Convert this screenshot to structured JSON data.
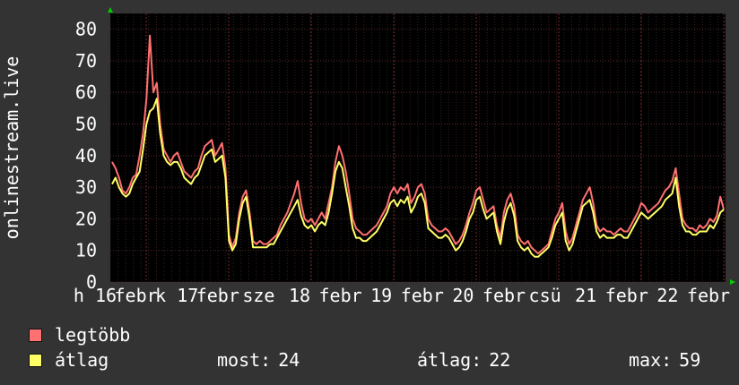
{
  "chart_data": {
    "type": "line",
    "ylabel": "onlinestream.live",
    "ylim": [
      0,
      85
    ],
    "yticks": [
      0,
      10,
      20,
      30,
      40,
      50,
      60,
      70,
      80
    ],
    "x_tick_labels": [
      "h 16",
      "febr",
      "k 17",
      "febr",
      "sze",
      "18",
      "febr",
      "19",
      "febr",
      "20",
      "febr",
      "csü",
      "21",
      "febr",
      "22",
      "febr"
    ],
    "grid": true,
    "background": "#000000",
    "series": [
      {
        "name": "legtöbb",
        "color": "#ff7070",
        "values": [
          38,
          36,
          33,
          29,
          28,
          30,
          33,
          34,
          40,
          47,
          58,
          78,
          60,
          63,
          50,
          42,
          40,
          38,
          40,
          41,
          38,
          35,
          34,
          33,
          35,
          36,
          40,
          43,
          44,
          45,
          40,
          42,
          44,
          36,
          15,
          11,
          14,
          22,
          27,
          29,
          22,
          13,
          12,
          13,
          12,
          12,
          13,
          14,
          15,
          18,
          20,
          22,
          25,
          28,
          32,
          25,
          20,
          19,
          20,
          18,
          20,
          22,
          20,
          25,
          30,
          38,
          43,
          40,
          35,
          28,
          20,
          17,
          16,
          15,
          15,
          16,
          17,
          18,
          20,
          22,
          24,
          28,
          30,
          28,
          30,
          29,
          31,
          25,
          27,
          30,
          31,
          28,
          20,
          18,
          17,
          16,
          16,
          17,
          16,
          14,
          12,
          13,
          15,
          18,
          22,
          25,
          29,
          30,
          26,
          22,
          23,
          24,
          18,
          14,
          22,
          26,
          28,
          24,
          15,
          13,
          12,
          13,
          11,
          10,
          9,
          10,
          11,
          12,
          16,
          20,
          22,
          25,
          16,
          12,
          14,
          18,
          22,
          26,
          28,
          30,
          25,
          18,
          16,
          17,
          16,
          16,
          15,
          16,
          17,
          16,
          16,
          18,
          20,
          22,
          25,
          24,
          22,
          23,
          24,
          25,
          27,
          29,
          30,
          32,
          36,
          28,
          20,
          18,
          17,
          17,
          16,
          18,
          17,
          18,
          20,
          19,
          21,
          27,
          23
        ]
      },
      {
        "name": "átlag",
        "color": "#ffff66",
        "values": [
          31,
          33,
          30,
          28,
          27,
          28,
          31,
          33,
          35,
          42,
          50,
          54,
          55,
          58,
          47,
          40,
          38,
          37,
          38,
          38,
          36,
          33,
          32,
          31,
          33,
          34,
          37,
          40,
          41,
          42,
          38,
          39,
          40,
          33,
          13,
          10,
          12,
          20,
          25,
          27,
          20,
          11,
          11,
          11,
          11,
          11,
          12,
          12,
          14,
          16,
          18,
          20,
          22,
          24,
          26,
          21,
          18,
          17,
          18,
          16,
          18,
          19,
          18,
          22,
          28,
          35,
          38,
          36,
          30,
          24,
          17,
          14,
          14,
          13,
          13,
          14,
          15,
          16,
          18,
          20,
          22,
          25,
          26,
          24,
          26,
          25,
          27,
          22,
          24,
          27,
          28,
          25,
          17,
          16,
          15,
          14,
          14,
          15,
          14,
          12,
          10,
          11,
          13,
          16,
          20,
          22,
          26,
          27,
          23,
          20,
          21,
          22,
          16,
          12,
          19,
          23,
          25,
          21,
          13,
          11,
          10,
          11,
          9,
          8,
          8,
          9,
          10,
          11,
          14,
          18,
          20,
          22,
          13,
          10,
          12,
          16,
          20,
          24,
          25,
          26,
          22,
          16,
          14,
          15,
          14,
          14,
          14,
          15,
          15,
          14,
          14,
          16,
          18,
          20,
          22,
          21,
          20,
          21,
          22,
          23,
          24,
          26,
          27,
          28,
          33,
          24,
          18,
          16,
          16,
          15,
          15,
          16,
          16,
          16,
          18,
          17,
          19,
          22,
          23
        ]
      }
    ]
  },
  "legend": {
    "max_label": "legtöbb",
    "avg_label": "átlag",
    "max_color": "#ff7070",
    "avg_color": "#ffff66"
  },
  "stats": {
    "now_label": "most:",
    "now_value": "24",
    "avg_label": "átlag:",
    "avg_value": "22",
    "max_label": "max:",
    "max_value": "59"
  }
}
